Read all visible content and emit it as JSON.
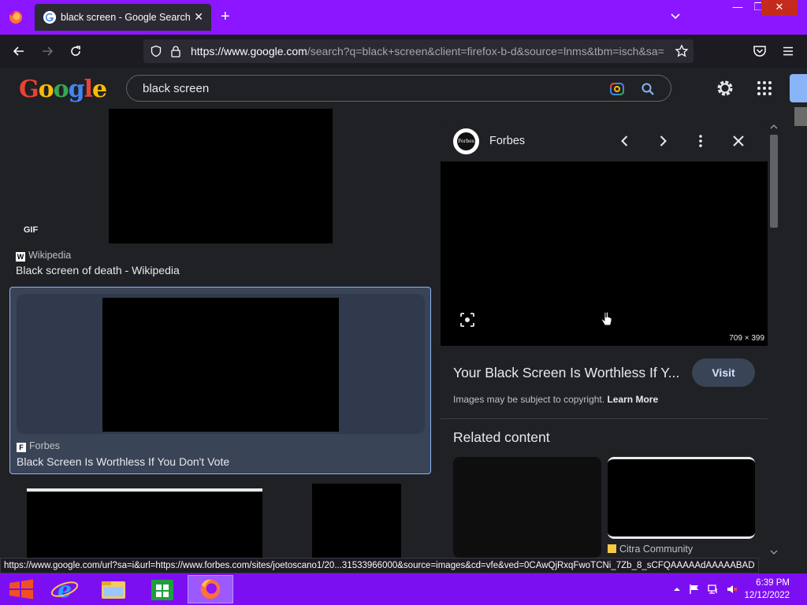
{
  "browser": {
    "tab_title": "black screen - Google Search",
    "tab_close": "✕",
    "new_tab": "+",
    "url_host": "https://www.google.com",
    "url_path": "/search?q=black+screen&client=firefox-b-d&source=lnms&tbm=isch&sa=",
    "window_min": "—",
    "window_max": "❐",
    "window_close": "✕"
  },
  "google": {
    "logo_letters": [
      "G",
      "o",
      "o",
      "g",
      "l",
      "e"
    ],
    "logo_colors": [
      "#ea4335",
      "#fbbc05",
      "#34a853",
      "#4285f4",
      "#ea4335",
      "#fbbc05"
    ],
    "search_query": "black screen"
  },
  "results": [
    {
      "badge": "GIF",
      "source_fav": "W",
      "source": "Wikipedia",
      "title": "Black screen of death - Wikipedia"
    },
    {
      "source_fav": "F",
      "source": "Forbes",
      "title": "Black Screen Is Worthless If You Don't Vote",
      "selected": true
    }
  ],
  "panel": {
    "source": "Forbes",
    "avatar_text": "Forbes",
    "dimensions": "709 × 399",
    "title": "Your Black Screen Is Worthless If Y...",
    "visit_label": "Visit",
    "copyright_text": "Images may be subject to copyright.",
    "learn_more": "Learn More",
    "related_heading": "Related content",
    "related_source": "Citra Community"
  },
  "status_url": "https://www.google.com/url?sa=i&url=https://www.forbes.com/sites/joetoscano1/20...31533966000&source=images&cd=vfe&ved=0CAwQjRxqFwoTCNi_7Zb_8_sCFQAAAAAdAAAAABAD",
  "taskbar": {
    "time": "6:39 PM",
    "date": "12/12/2022"
  },
  "colors": {
    "firefox_frame": "#8b16ff",
    "taskbar": "#7c0ff2",
    "google_bg": "#202124",
    "selection_border": "#8ab4f8"
  }
}
